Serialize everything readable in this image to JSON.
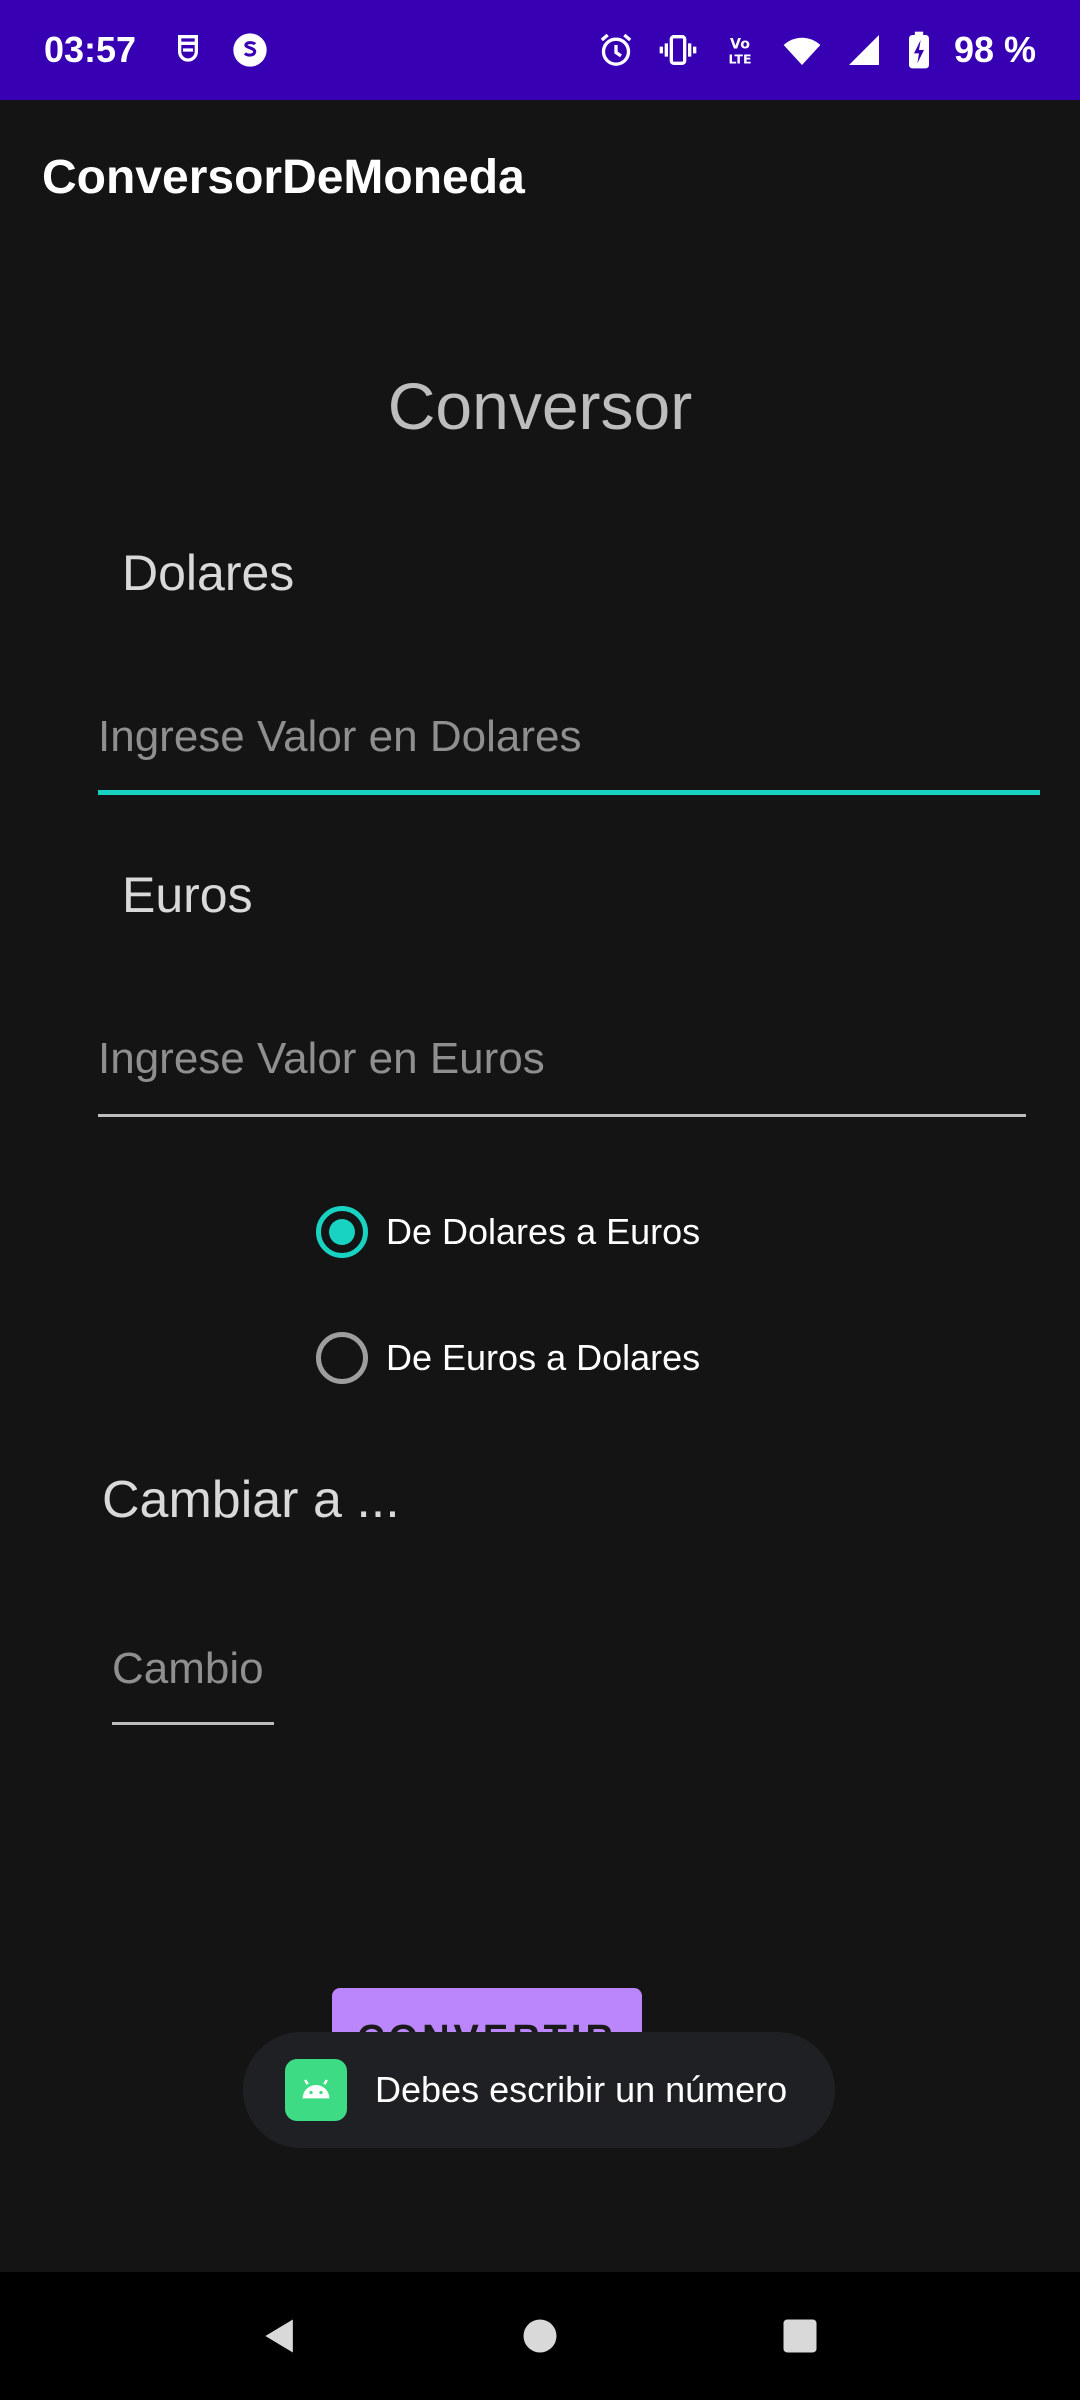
{
  "status_bar": {
    "time": "03:57",
    "battery": "98 %",
    "left_icons": [
      "shield-icon",
      "s-circle-icon"
    ],
    "right_icons": [
      "alarm-icon",
      "vibrate-icon",
      "volte-icon",
      "wifi-icon",
      "signal-icon",
      "battery-charging-icon"
    ],
    "background": "#3700b3"
  },
  "app_bar": {
    "title": "ConversorDeMoneda"
  },
  "main": {
    "heading": "Conversor",
    "dolares_label": "Dolares",
    "dolares_input": {
      "value": "",
      "placeholder": "Ingrese Valor en Dolares"
    },
    "euros_label": "Euros",
    "euros_input": {
      "value": "",
      "placeholder": "Ingrese Valor en Euros"
    },
    "radio_options": [
      {
        "label": "De Dolares a Euros",
        "checked": true
      },
      {
        "label": "De Euros a Dolares",
        "checked": false
      }
    ],
    "cambiar_label": "Cambiar a ...",
    "cambio_input": {
      "value": "",
      "placeholder": "Cambio"
    },
    "convert_button": "CONVERTIR"
  },
  "toast": {
    "message": "Debes escribir un número",
    "icon": "android-icon"
  },
  "nav_bar": {
    "buttons": [
      "back-icon",
      "home-icon",
      "recents-icon"
    ]
  },
  "colors": {
    "accent": "#18d3c2",
    "button": "#bb86fc",
    "background": "#141414"
  }
}
